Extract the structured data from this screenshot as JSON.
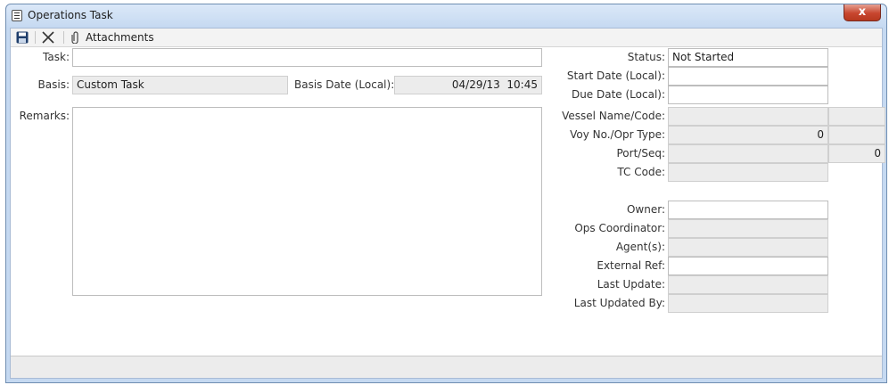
{
  "window": {
    "title": "Operations Task",
    "close_label": "x"
  },
  "toolbar": {
    "save_icon": "floppy-disk-icon",
    "delete_icon": "x-icon",
    "attachments_icon": "paperclip-icon",
    "attachments_label": "Attachments"
  },
  "form": {
    "task_label": "Task:",
    "task_value": "",
    "basis_label": "Basis:",
    "basis_value": "Custom Task",
    "basis_date_label": "Basis Date (Local):",
    "basis_date_value": "04/29/13  10:45",
    "remarks_label": "Remarks:",
    "remarks_value": "",
    "status_label": "Status:",
    "status_value": "Not Started",
    "start_date_label": "Start Date (Local):",
    "start_date_value": "",
    "due_date_label": "Due Date (Local):",
    "due_date_value": "",
    "vessel_label": "Vessel Name/Code:",
    "vessel_name_value": "",
    "vessel_code_value": "",
    "voy_label": "Voy No./Opr Type:",
    "voy_no_value": "0",
    "opr_type_value": "",
    "port_label": "Port/Seq:",
    "port_value": "",
    "seq_value": "0",
    "tc_label": "TC Code:",
    "tc_value": "",
    "owner_label": "Owner:",
    "owner_value": "",
    "ops_label": "Ops Coordinator:",
    "ops_value": "",
    "agents_label": "Agent(s):",
    "agents_value": "",
    "ext_ref_label": "External Ref:",
    "ext_ref_value": "",
    "last_update_label": "Last Update:",
    "last_update_value": "",
    "last_updated_by_label": "Last Updated By:",
    "last_updated_by_value": ""
  },
  "status_bar": {
    "text": ""
  }
}
